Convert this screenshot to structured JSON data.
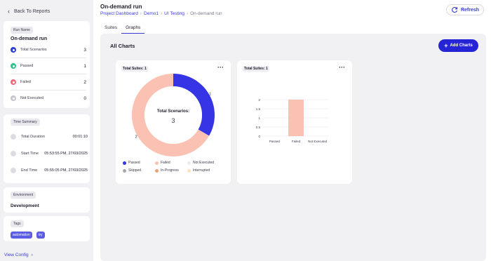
{
  "sidebar": {
    "back_label": "Back To Reports",
    "run_section_label": "Run Name",
    "run_name": "On-demand run",
    "stats": [
      {
        "label": "Total Scenarios",
        "value": "3",
        "color": "#2d3bd8"
      },
      {
        "label": "Passed",
        "value": "1",
        "color": "#2fc28a"
      },
      {
        "label": "Failed",
        "value": "2",
        "color": "#ee6b7b"
      },
      {
        "label": "Not Executed",
        "value": "0",
        "color": "#c6c6cf"
      }
    ],
    "time_section_label": "Time Summary",
    "time_rows": [
      {
        "label": "Total Duration",
        "value": "00:01:10"
      },
      {
        "label": "Start Time",
        "value": "05:53:55 PM, 27/03/2025"
      },
      {
        "label": "End Time",
        "value": "05:55:05 PM, 27/03/2025"
      }
    ],
    "environment_label": "Environment",
    "environment_value": "Development",
    "tags_label": "Tags",
    "tags": [
      "automation",
      "try"
    ],
    "view_config_label": "View Config"
  },
  "header": {
    "title": "On-demand run",
    "breadcrumb": [
      "Project Dashboard",
      "Demo1",
      "UI Testing",
      "On-demand run"
    ],
    "refresh_label": "Refresh"
  },
  "tabs": [
    {
      "label": "Suites",
      "active": false
    },
    {
      "label": "Graphs",
      "active": true
    }
  ],
  "main": {
    "section_title": "All Charts",
    "add_charts_label": "Add Charts"
  },
  "chart_data": [
    {
      "type": "pie",
      "title": "Total Suites: 1",
      "center_label": "Total Scenarios:",
      "center_value": "3",
      "slices": [
        {
          "name": "Passed",
          "value": 1,
          "color": "#3535e6"
        },
        {
          "name": "Failed",
          "value": 2,
          "color": "#fbc2b3"
        }
      ],
      "legend": [
        {
          "name": "Passed",
          "color": "#3535e6"
        },
        {
          "name": "Failed",
          "color": "#fbc2b3"
        },
        {
          "name": "Not Executed",
          "color": "#ececec"
        },
        {
          "name": "Skipped",
          "color": "#a7a7ad"
        },
        {
          "name": "In-Progress",
          "color": "#f0a070"
        },
        {
          "name": "Interrupted",
          "color": "#fde0c2"
        }
      ]
    },
    {
      "type": "bar",
      "title": "Total Suites: 1",
      "categories": [
        "Passed",
        "Failed",
        "Not Executed"
      ],
      "values": [
        0,
        2,
        0
      ],
      "yticks": [
        "0",
        "0.5",
        "1",
        "1.5",
        "2"
      ],
      "ylim": [
        0,
        2
      ],
      "bar_color": "#fbc2b3",
      "grid": true
    }
  ]
}
